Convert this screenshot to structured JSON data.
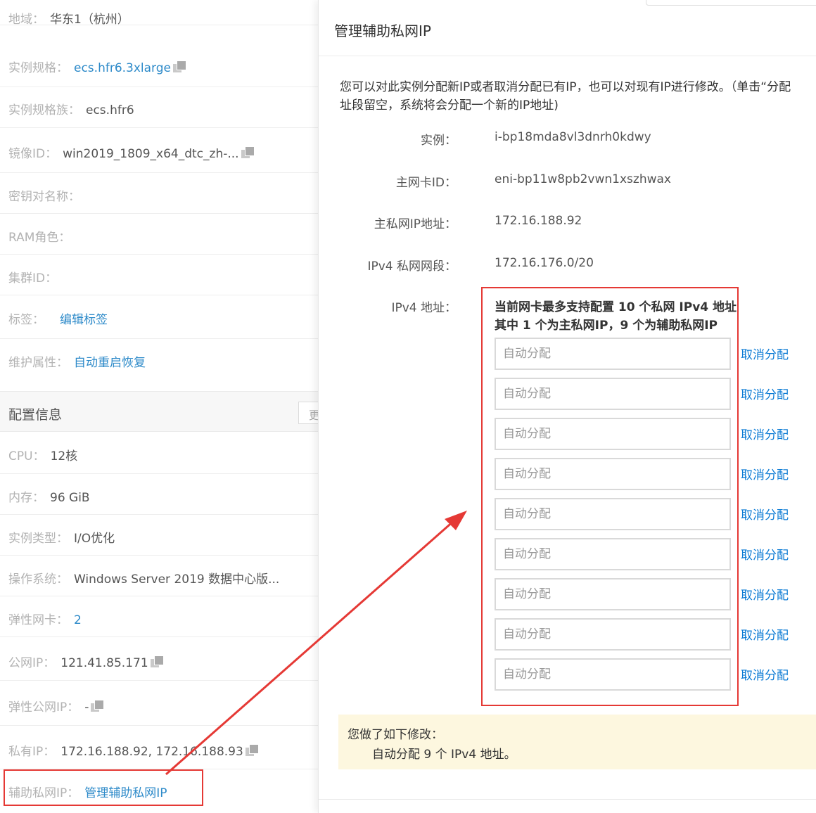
{
  "left": {
    "rows": [
      {
        "label": "地域：",
        "value": "华东1（杭州）"
      },
      {
        "label": "实例规格：",
        "link": "ecs.hfr6.3xlarge"
      },
      {
        "label": "实例规格族：",
        "value": "ecs.hfr6"
      },
      {
        "label": "镜像ID：",
        "value": "win2019_1809_x64_dtc_zh-..."
      },
      {
        "label": "密钥对名称：",
        "value": ""
      },
      {
        "label": "RAM角色：",
        "value": ""
      },
      {
        "label": "集群ID：",
        "value": ""
      },
      {
        "label": "标签：",
        "link": "编辑标签"
      },
      {
        "label": "维护属性：",
        "link": "自动重启恢复"
      }
    ],
    "config_title": "配置信息",
    "config_button": "更",
    "config_rows": [
      {
        "label": "CPU：",
        "value": "12核"
      },
      {
        "label": "内存：",
        "value": "96 GiB"
      },
      {
        "label": "实例类型：",
        "value": "I/O优化"
      },
      {
        "label": "操作系统：",
        "value": "Windows Server 2019 数据中心版..."
      },
      {
        "label": "弹性网卡：",
        "link": "2"
      },
      {
        "label": "公网IP：",
        "value": "121.41.85.171"
      },
      {
        "label": "弹性公网IP：",
        "value": "-"
      },
      {
        "label": "私有IP：",
        "value": "172.16.188.92, 172.16.188.93"
      },
      {
        "label": "辅助私网IP：",
        "link": "管理辅助私网IP"
      }
    ]
  },
  "dialog": {
    "title": "管理辅助私网IP",
    "description": "您可以对此实例分配新IP或者取消分配已有IP，也可以对现有IP进行修改。（单击“分配",
    "description_line2": "址段留空，系统将会分配一个新的IP地址)",
    "fields": [
      {
        "label": "实例：",
        "value": "i-bp18mda8vl3dnrh0kdwy"
      },
      {
        "label": "主网卡ID：",
        "value": "eni-bp11w8pb2vwn1xszhwax"
      },
      {
        "label": "主私网IP地址：",
        "value": "172.16.188.92"
      },
      {
        "label": "IPv4 私网网段：",
        "value": "172.16.176.0/20"
      }
    ],
    "ipv4_label": "IPv4 地址：",
    "ipv4_notice_line1": "当前网卡最多支持配置 10 个私网 IPv4 地址",
    "ipv4_notice_line2": "其中 1 个为主私网IP，9 个为辅助私网IP",
    "ip_placeholder": "自动分配",
    "ip_cancel_label": "取消分配",
    "ip_count": 9,
    "change_title": "您做了如下修改：",
    "change_item": "自动分配 9 个 IPv4 地址。"
  },
  "colors": {
    "link": "#2d8ac9",
    "cancel_link": "#0a7ad4",
    "annotation": "#e53935",
    "change_bg": "#fdf7df"
  }
}
